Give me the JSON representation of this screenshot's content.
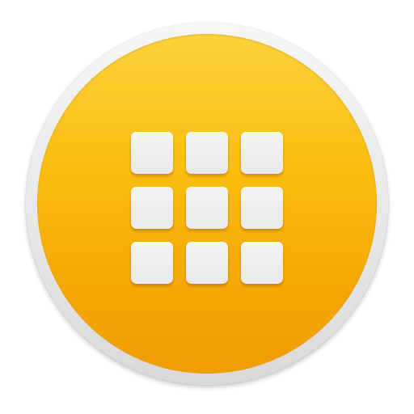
{
  "icon": {
    "name": "app-grid-icon",
    "ring_color": "#e8e8e8",
    "disc_top_color": "#fdd23a",
    "disc_bottom_color": "#f09d02",
    "tile_color": "#ececec",
    "tiles": {
      "rows": 3,
      "columns": 3
    }
  }
}
